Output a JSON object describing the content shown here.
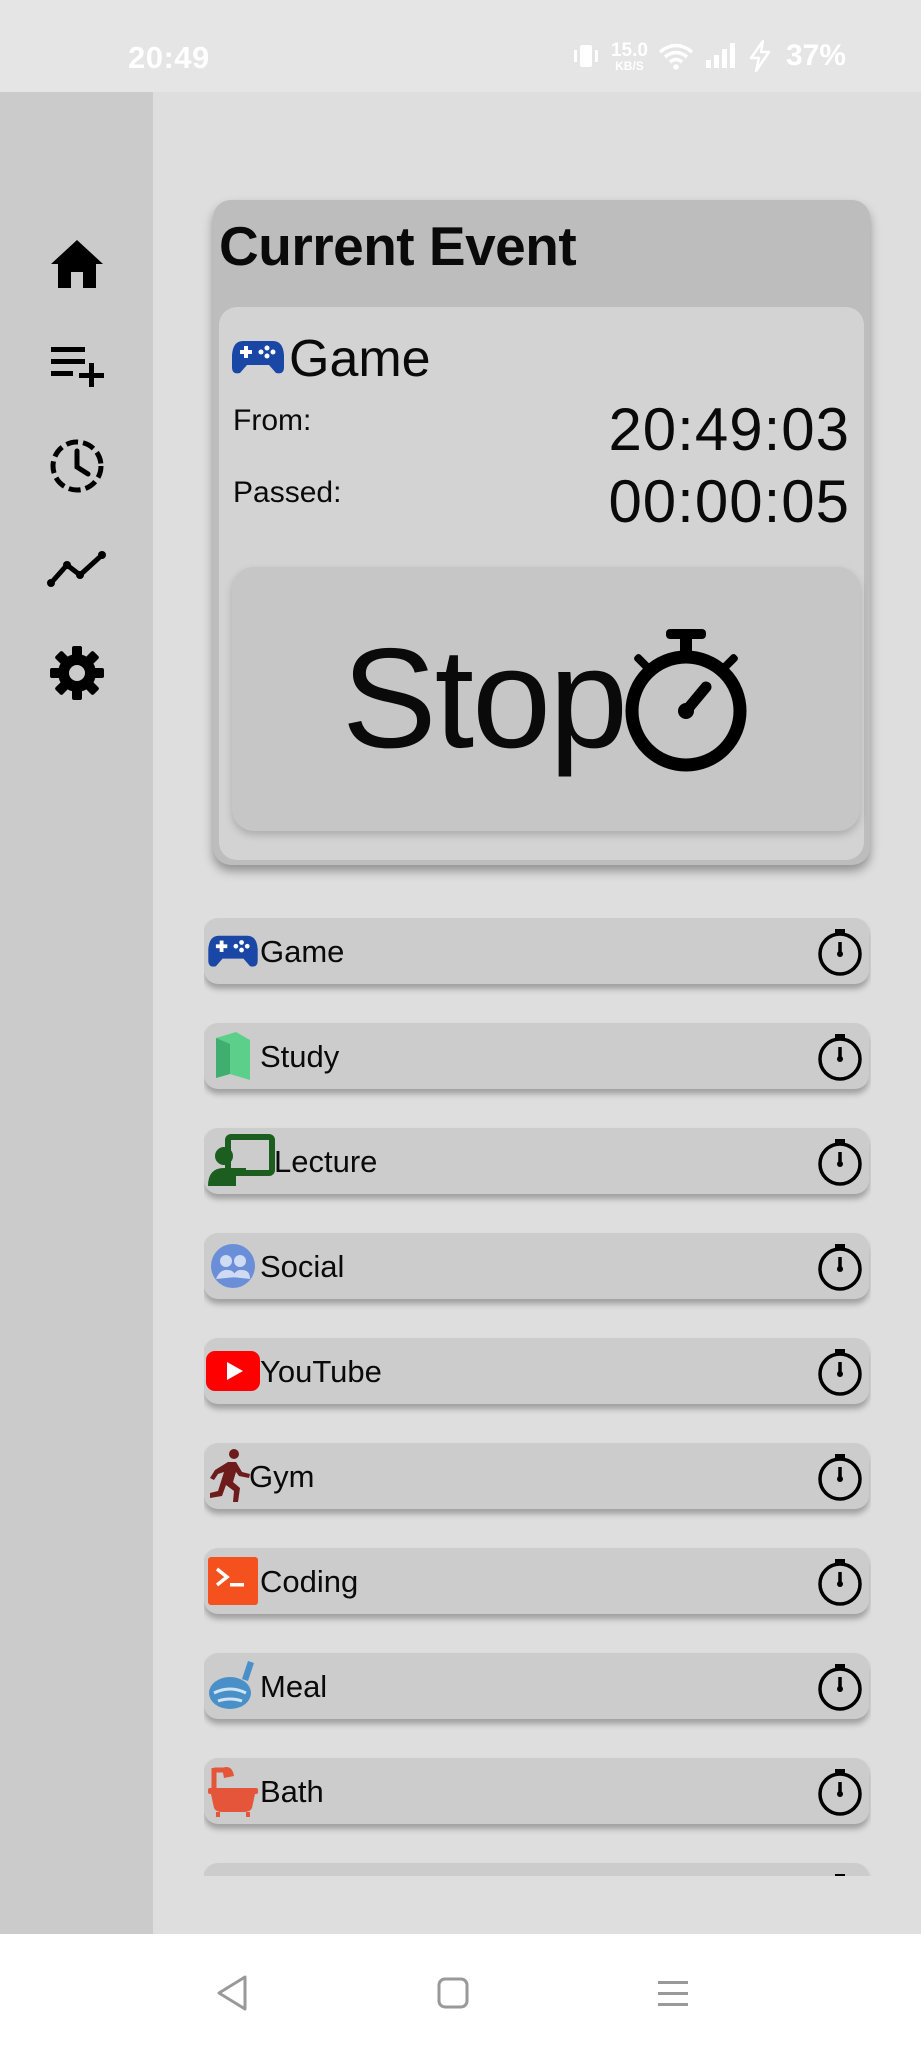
{
  "status_bar": {
    "time": "20:49",
    "net_speed_value": "15.0",
    "net_speed_unit": "KB/S",
    "battery": "37%",
    "icons": [
      "vibrate-icon",
      "wifi-icon",
      "signal-icon",
      "charging-icon"
    ]
  },
  "sidebar": {
    "items": [
      {
        "name": "home",
        "icon": "home-icon"
      },
      {
        "name": "add-event",
        "icon": "playlist-add-icon"
      },
      {
        "name": "history",
        "icon": "history-clock-icon"
      },
      {
        "name": "stats",
        "icon": "trend-line-icon"
      },
      {
        "name": "settings",
        "icon": "gear-icon"
      }
    ]
  },
  "current_event": {
    "title": "Current Event",
    "name": "Game",
    "icon": "gamepad-icon",
    "from_label": "From:",
    "passed_label": "Passed:",
    "from_value": "20:49:03",
    "passed_value": "00:00:05",
    "stop_label": "Stop",
    "stop_icon": "stopwatch-icon"
  },
  "events": [
    {
      "label": "Game",
      "icon": "gamepad-icon",
      "color": "#1a47a6"
    },
    {
      "label": "Study",
      "icon": "book-icon",
      "color": "#5cd08a"
    },
    {
      "label": "Lecture",
      "icon": "presenter-icon",
      "color": "#1b5e20"
    },
    {
      "label": "Social",
      "icon": "group-icon",
      "color": "#6a8fd8"
    },
    {
      "label": "YouTube",
      "icon": "youtube-icon",
      "color": "#ff0000"
    },
    {
      "label": "Gym",
      "icon": "running-icon",
      "color": "#6d1b1b"
    },
    {
      "label": "Coding",
      "icon": "terminal-icon",
      "color": "#f4511e"
    },
    {
      "label": "Meal",
      "icon": "meal-icon",
      "color": "#4a90c8"
    },
    {
      "label": "Bath",
      "icon": "bathtub-icon",
      "color": "#e4553a"
    },
    {
      "label": "",
      "icon": "partial-icon",
      "color": "#9c4aa0"
    }
  ],
  "nav_bar": {
    "buttons": [
      "back-icon",
      "home-square-icon",
      "menu-icon"
    ]
  }
}
